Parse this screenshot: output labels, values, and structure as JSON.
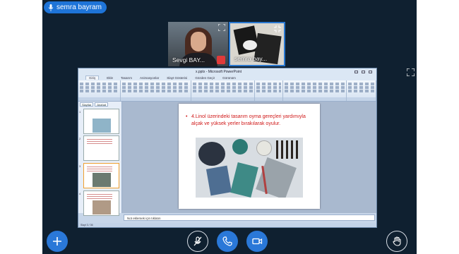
{
  "presenter": {
    "name": "semra bayram"
  },
  "participants": [
    {
      "name": "Sevgi BAY..."
    },
    {
      "name": "semra bay..."
    }
  ],
  "ppt": {
    "window_title": "x.pptx - Microsoft PowerPoint",
    "tabs": [
      "Giriş",
      "Ekle",
      "Tasarım",
      "Animasyonlar",
      "Slayt Gösterisi",
      "Gözden Geçir",
      "Görünüm"
    ],
    "panel_tabs": [
      "Slaytlar",
      "Anahat"
    ],
    "thumb_numbers": [
      "1",
      "2",
      "3",
      "4"
    ],
    "slide": {
      "bullet": "4.Linol üzerindeki tasarım oyma gereçleri yardımıyla alçak ve yüksek yerler bırakılarak oyulur."
    },
    "notes_placeholder": "Not eklemek için tıklatın",
    "status": "Slayt 3 / 36"
  },
  "controls": {
    "add": "plus-icon",
    "mic": "mic-off-icon",
    "call": "phone-icon",
    "camera": "video-camera-icon",
    "raise": "hand-icon"
  },
  "colors": {
    "accent": "#2a78d8",
    "background": "#0f2030",
    "slide_text": "#d01818"
  }
}
